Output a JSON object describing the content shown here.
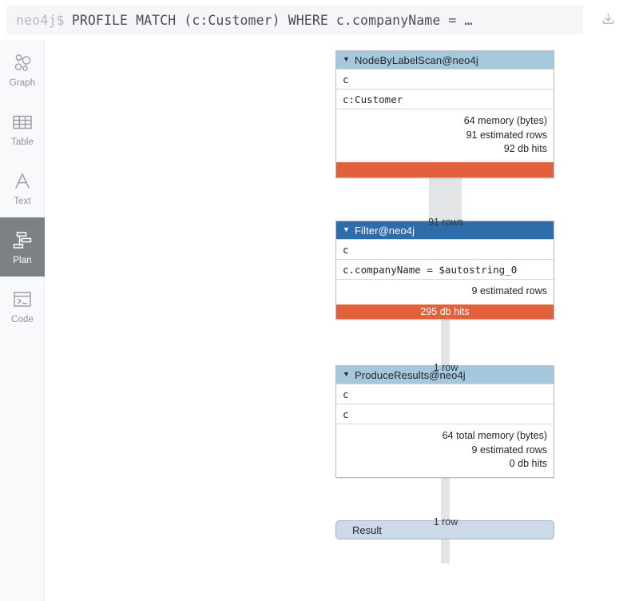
{
  "header": {
    "prompt": "neo4j$",
    "query": "PROFILE MATCH (c:Customer) WHERE c.companyName = …",
    "download_icon": "download-icon"
  },
  "sidebar": {
    "items": [
      {
        "label": "Graph",
        "icon": "graph-icon",
        "active": false
      },
      {
        "label": "Table",
        "icon": "table-icon",
        "active": false
      },
      {
        "label": "Text",
        "icon": "text-icon",
        "active": false
      },
      {
        "label": "Plan",
        "icon": "plan-icon",
        "active": true
      },
      {
        "label": "Code",
        "icon": "code-icon",
        "active": false
      }
    ]
  },
  "plan": {
    "operators": [
      {
        "title": "NodeByLabelScan@neo4j",
        "header_style": "light",
        "caret": "▼",
        "rows": [
          "c",
          "c:Customer"
        ],
        "stats": [
          "64 memory (bytes)",
          "91 estimated rows",
          "92 db hits"
        ],
        "bar_label": "",
        "bar_color": "#e2613c"
      },
      {
        "title": "Filter@neo4j",
        "header_style": "dark",
        "caret": "▼",
        "rows": [
          "c",
          "c.companyName = $autostring_0"
        ],
        "stats": [
          "9 estimated rows"
        ],
        "bar_label": "295 db hits",
        "bar_color": "#e2613c"
      },
      {
        "title": "ProduceResults@neo4j",
        "header_style": "light",
        "caret": "▼",
        "rows": [
          "c",
          "c"
        ],
        "stats": [
          "64 total memory (bytes)",
          "9 estimated rows",
          "0 db hits"
        ],
        "bar_label": null,
        "bar_color": null
      }
    ],
    "connectors": [
      {
        "label": "91 rows"
      },
      {
        "label": "1 row"
      },
      {
        "label": "1 row"
      }
    ],
    "result": {
      "label": "Result"
    }
  }
}
